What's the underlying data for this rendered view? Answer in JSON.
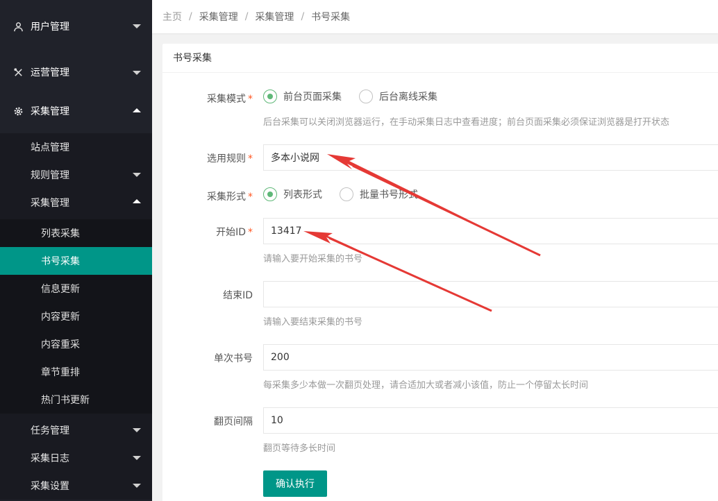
{
  "sidebar": {
    "items": [
      {
        "label": "用户管理",
        "icon": "user-icon",
        "expanded": false
      },
      {
        "label": "运营管理",
        "icon": "tools-icon",
        "expanded": false
      },
      {
        "label": "采集管理",
        "icon": "gear-icon",
        "expanded": true
      }
    ],
    "collect": {
      "subitems": [
        {
          "label": "站点管理"
        },
        {
          "label": "规则管理",
          "expanded": false
        },
        {
          "label": "采集管理",
          "expanded": true
        }
      ],
      "leaves": [
        "列表采集",
        "书号采集",
        "信息更新",
        "内容更新",
        "内容重采",
        "章节重排",
        "热门书更新"
      ],
      "active_leaf": "书号采集",
      "after": [
        {
          "label": "任务管理",
          "expanded": false
        },
        {
          "label": "采集日志",
          "expanded": false
        },
        {
          "label": "采集设置",
          "expanded": false
        }
      ]
    }
  },
  "breadcrumb": [
    "主页",
    "采集管理",
    "采集管理",
    "书号采集"
  ],
  "card": {
    "title": "书号采集"
  },
  "form": {
    "mode": {
      "label": "采集模式",
      "options": [
        "前台页面采集",
        "后台离线采集"
      ],
      "selected": "前台页面采集",
      "hint": "后台采集可以关闭浏览器运行，在手动采集日志中查看进度；前台页面采集必须保证浏览器是打开状态"
    },
    "rule": {
      "label": "选用规则",
      "value": "多本小说网"
    },
    "format": {
      "label": "采集形式",
      "options": [
        "列表形式",
        "批量书号形式"
      ],
      "selected": "列表形式"
    },
    "start_id": {
      "label": "开始ID",
      "value": "13417",
      "hint": "请输入要开始采集的书号"
    },
    "end_id": {
      "label": "结束ID",
      "value": "",
      "hint": "请输入要结束采集的书号"
    },
    "batch": {
      "label": "单次书号",
      "value": "200",
      "hint": "每采集多少本做一次翻页处理，请合适加大或者减小该值，防止一个停留太长时间"
    },
    "interval": {
      "label": "翻页间隔",
      "value": "10",
      "hint": "翻页等待多长时间"
    },
    "required_mark": "*",
    "submit_label": "确认执行"
  },
  "colors": {
    "accent": "#009688",
    "sidebar_bg": "#20222a",
    "radio_checked": "#5fb878",
    "required": "#ff5722",
    "annotation_arrow": "#e53935"
  }
}
